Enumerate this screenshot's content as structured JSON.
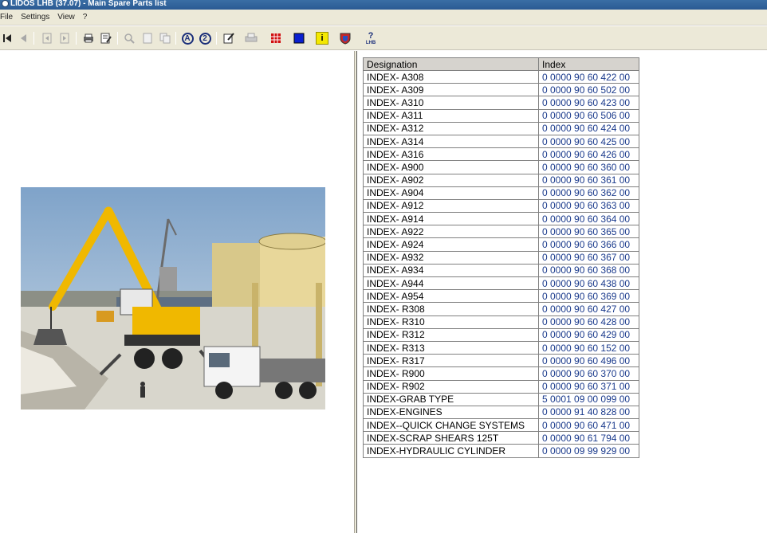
{
  "window": {
    "title": "LIDOS LHB  (37.07) - Main Spare Parts list"
  },
  "menu": {
    "items": [
      "File",
      "Settings",
      "View",
      "?"
    ]
  },
  "toolbar": {
    "icons": [
      "first-page-icon",
      "previous-page-icon",
      "jump-back-icon",
      "jump-forward-icon",
      "print-list-icon",
      "edit-list-icon",
      "zoom-icon",
      "page-view-icon",
      "copy-view-icon",
      "mark-a-icon",
      "mark-2-icon",
      "note-icon",
      "printer-icon",
      "grid-icon",
      "blue-square-icon",
      "info-icon",
      "shield-icon",
      "lidos-help-icon"
    ],
    "mark_a": "A",
    "mark_2": "2",
    "info": "i",
    "help": "LHB"
  },
  "colors": {
    "index_text": "#1a3a8c",
    "titlebar": "#2b5a93",
    "header_bg": "#d6d3ce",
    "chrome": "#ece9d8"
  },
  "table": {
    "headers": [
      "Designation",
      "Index"
    ],
    "rows": [
      [
        "INDEX- A308",
        "0 0000  90 60 422 00"
      ],
      [
        "INDEX- A309",
        "0 0000  90 60 502 00"
      ],
      [
        "INDEX- A310",
        "0 0000  90 60 423 00"
      ],
      [
        "INDEX- A311",
        "0 0000  90 60 506 00"
      ],
      [
        "INDEX- A312",
        "0 0000  90 60 424 00"
      ],
      [
        "INDEX- A314",
        "0 0000  90 60 425 00"
      ],
      [
        "INDEX- A316",
        "0 0000  90 60 426 00"
      ],
      [
        "INDEX- A900",
        "0 0000  90 60 360 00"
      ],
      [
        "INDEX- A902",
        "0 0000  90 60 361 00"
      ],
      [
        "INDEX- A904",
        "0 0000  90 60 362 00"
      ],
      [
        "INDEX- A912",
        "0 0000  90 60 363 00"
      ],
      [
        "INDEX- A914",
        "0 0000  90 60 364 00"
      ],
      [
        "INDEX- A922",
        "0 0000  90 60 365 00"
      ],
      [
        "INDEX- A924",
        "0 0000  90 60 366 00"
      ],
      [
        "INDEX- A932",
        "0 0000  90 60 367 00"
      ],
      [
        "INDEX- A934",
        "0 0000  90 60 368 00"
      ],
      [
        "INDEX- A944",
        "0 0000  90 60 438 00"
      ],
      [
        "INDEX- A954",
        "0 0000  90 60 369 00"
      ],
      [
        "INDEX- R308",
        "0 0000  90 60 427 00"
      ],
      [
        "INDEX- R310",
        "0 0000  90 60 428 00"
      ],
      [
        "INDEX- R312",
        "0 0000  90 60 429 00"
      ],
      [
        "INDEX- R313",
        "0 0000  90 60 152 00"
      ],
      [
        "INDEX- R317",
        "0 0000  90 60 496 00"
      ],
      [
        "INDEX- R900",
        "0 0000  90 60 370 00"
      ],
      [
        "INDEX- R902",
        "0 0000  90 60 371 00"
      ],
      [
        "INDEX-GRAB TYPE",
        "5 0001  09 00 099 00"
      ],
      [
        "INDEX-ENGINES",
        "0 0000  91 40 828 00"
      ],
      [
        "INDEX--QUICK CHANGE SYSTEMS",
        "0 0000  90 60 471 00"
      ],
      [
        "INDEX-SCRAP SHEARS 125T",
        "0 0000  90 61 794 00"
      ],
      [
        "INDEX-HYDRAULIC CYLINDER",
        "0 0000  09 99 929 00"
      ]
    ]
  }
}
